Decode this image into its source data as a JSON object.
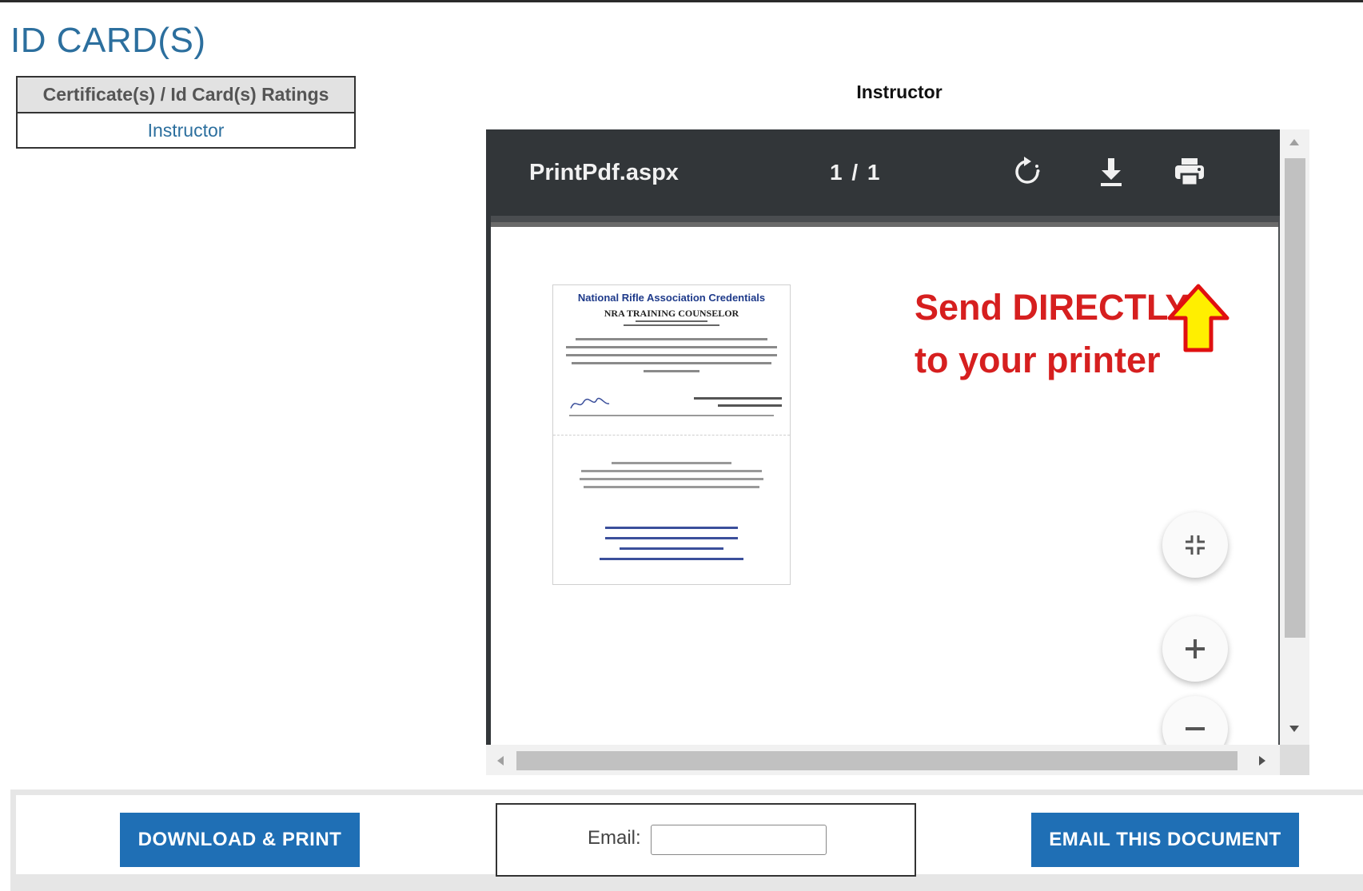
{
  "page": {
    "title": "ID CARD(S)"
  },
  "ratings": {
    "header": "Certificate(s) / Id Card(s) Ratings",
    "items": [
      "Instructor"
    ]
  },
  "viewer": {
    "caption": "Instructor",
    "file_name": "PrintPdf.aspx",
    "page_indicator": "1 / 1",
    "icons": {
      "rotate": "rotate-icon",
      "download": "download-icon",
      "print": "print-icon",
      "fit": "fit-page-icon",
      "zoom_in": "plus-icon",
      "zoom_out": "minus-icon"
    }
  },
  "annotation": {
    "line1": "Send DIRECTLY",
    "line2": "to your printer",
    "color": "#d61f1f",
    "arrow_fill": "#ffef00"
  },
  "card": {
    "heading": "National Rifle Association Credentials",
    "subheading": "NRA TRAINING COUNSELOR"
  },
  "actions": {
    "download_print": "DOWNLOAD & PRINT",
    "email_label": "Email:",
    "email_value": "",
    "email_button": "EMAIL THIS DOCUMENT"
  },
  "colors": {
    "accent": "#1f6fb5",
    "title": "#2c6f9e",
    "toolbar": "#323639"
  }
}
